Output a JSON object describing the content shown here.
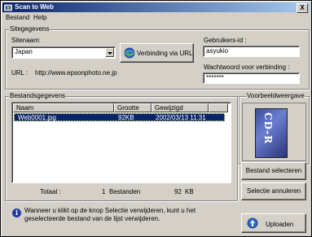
{
  "window": {
    "title": "Scan to Web",
    "close_label": "X"
  },
  "menu": [
    {
      "label": "Bestand"
    },
    {
      "label": "Help"
    }
  ],
  "site_group": {
    "title": "Sitegegevens",
    "sitename_label": "Sitenaam:",
    "sitename_value": "Japan",
    "connect_button": "Verbinding via URL",
    "url_label": "URL :",
    "url_value": "http://www.epsonphoto.ne.jp",
    "userid_label": "Gebruikers-id :",
    "userid_value": "asyukio",
    "password_label": "Wachtwoord voor verbinding :",
    "password_value": "*******"
  },
  "file_group": {
    "title": "Bestandsgegevens",
    "columns": [
      "Naam",
      "Grootte",
      "Gewijzigd"
    ],
    "rows": [
      {
        "name": "Web0001.jpg",
        "size": "92KB",
        "modified": "2002/03/13 11:31"
      }
    ],
    "total_label": "Totaal :",
    "total_count": "1",
    "total_files_label": "Bestanden",
    "total_size": "92",
    "total_size_unit": "KB"
  },
  "preview": {
    "title": "Voorbeeldweergave",
    "thumbnail_text": "CD-R"
  },
  "buttons": {
    "select_file": "Bestand selecteren",
    "cancel_selection": "Selectie annuleren",
    "upload": "Uploaden"
  },
  "info": {
    "icon_char": "i",
    "message": "Wanneer u klikt op de knop Selectie verwijderen, kunt u het geselecteerde bestand van de lijst verwijderen."
  }
}
